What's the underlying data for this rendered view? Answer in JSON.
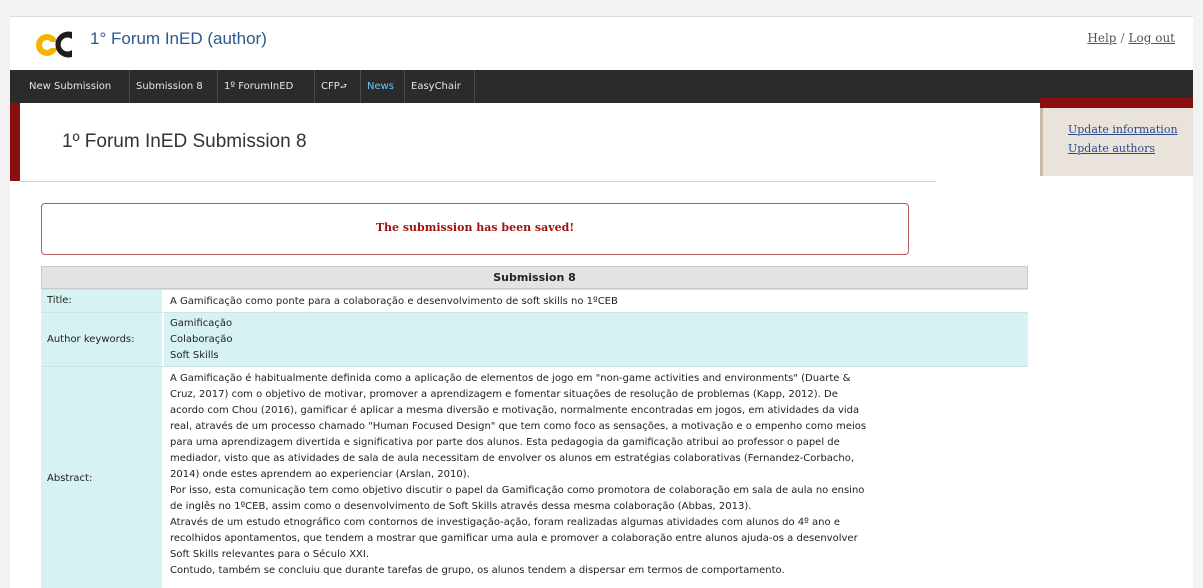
{
  "app": {
    "title": "1° Forum InED (author)",
    "links": {
      "help": "Help",
      "separator": "/",
      "logout": "Log out"
    }
  },
  "nav": {
    "items": [
      "New Submission",
      "Submission 8",
      "1º ForumInED",
      "CFP",
      "News",
      "EasyChair"
    ]
  },
  "sidebar": {
    "update_information": "Update information",
    "update_authors": "Update authors"
  },
  "page": {
    "title": "1º Forum InED Submission 8"
  },
  "message": "The submission has been saved!",
  "submission": {
    "header": "Submission 8",
    "title_label": "Title:",
    "title": "A Gamificação como ponte para a colaboração e desenvolvimento de soft skills no 1ºCEB",
    "keywords_label": "Author keywords:",
    "keywords": [
      "Gamificação",
      "Colaboração",
      "Soft Skills"
    ],
    "abstract_label": "Abstract:",
    "abstract_lines": [
      "A Gamificação é habitualmente definida como a aplicação de elementos de jogo em \"non-game activities and environments\" (Duarte &",
      "Cruz, 2017) com o objetivo de motivar, promover a aprendizagem e fomentar situações de resolução de problemas (Kapp, 2012). De",
      "acordo com Chou (2016), gamificar é aplicar a mesma diversão e motivação, normalmente encontradas em jogos, em atividades da vida",
      "real, através de um processo chamado \"Human Focused Design\" que tem como foco as sensações, a motivação e o empenho como meios",
      "para uma aprendizagem divertida e significativa por parte dos alunos. Esta pedagogia da gamificação atribui ao professor o papel de",
      "mediador, visto que as atividades de sala de aula necessitam de envolver os alunos em estratégias colaborativas (Fernandez-Corbacho,",
      "2014) onde estes aprendem ao experienciar (Arslan, 2010).",
      "Por isso, esta comunicação tem como objetivo discutir o papel da Gamificação como promotora de colaboração em sala de aula no ensino",
      "de inglês no 1ºCEB, assim como o desenvolvimento de Soft Skills através dessa mesma colaboração (Abbas, 2013).",
      "Através de um estudo etnográfico com contornos de investigação-ação, foram realizadas algumas atividades com alunos do 4º ano e",
      "recolhidos apontamentos, que tendem a mostrar que gamificar uma aula e promover a colaboração entre alunos ajuda-os a desenvolver",
      "Soft Skills relevantes para o Século XXI.",
      "Contudo, também se concluiu que durante tarefas de grupo, os alunos tendem a dispersar em termos de comportamento."
    ]
  },
  "colors": {
    "accent": "#8a0f0f",
    "nav_bg": "#2b2b2b",
    "label_bg": "#d6f2f2",
    "message": "#a31212"
  }
}
